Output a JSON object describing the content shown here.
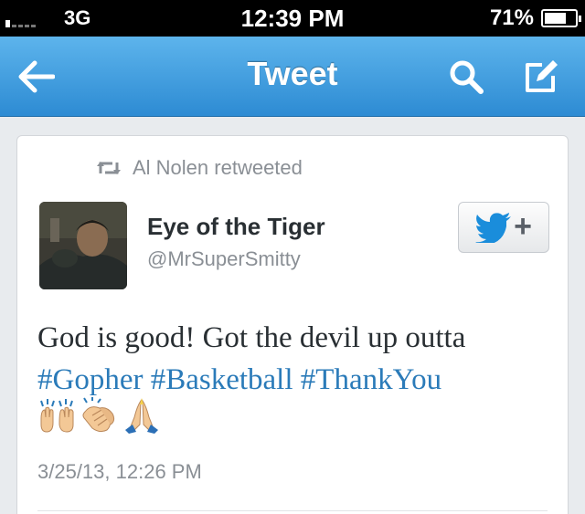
{
  "status_bar": {
    "carrier": "3G",
    "time": "12:39 PM",
    "battery_percent": "71%",
    "battery_level": 0.71
  },
  "nav": {
    "title": "Tweet",
    "icons": {
      "back": "back-arrow-icon",
      "search": "search-icon",
      "compose": "compose-icon"
    },
    "color": "#3a9ae0"
  },
  "tweet": {
    "retweet_label": "Al Nolen retweeted",
    "user": {
      "name": "Eye of the Tiger",
      "handle": "@MrSuperSmitty"
    },
    "follow_icon": "follow-bird-plus-icon",
    "follow_plus": "+",
    "text_line1": "God is good! Got the devil up outta",
    "hashtags": [
      "#Gopher",
      "#Basketball",
      "#ThankYou"
    ],
    "emojis": [
      "raised-hands-icon",
      "clapping-hands-icon",
      "praying-hands-icon"
    ],
    "timestamp": "3/25/13, 12:26 PM",
    "link_color": "#2b7bb9"
  }
}
